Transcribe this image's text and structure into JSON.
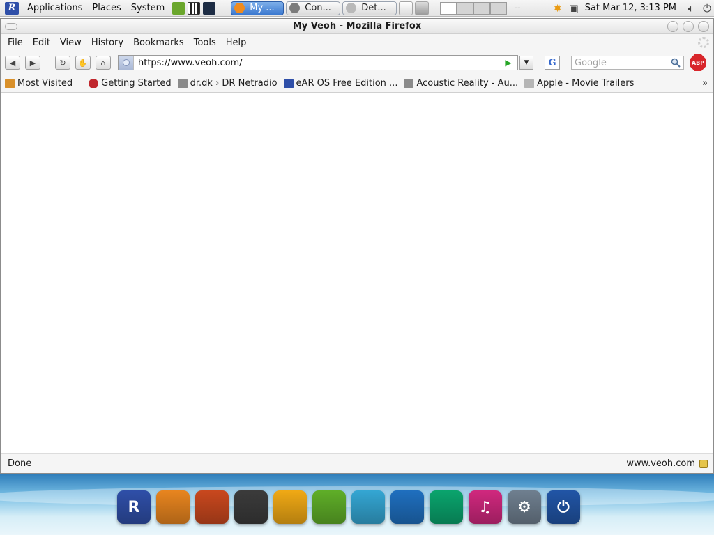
{
  "panel": {
    "logo_letter": "R",
    "menus": [
      "Applications",
      "Places",
      "System"
    ],
    "tasks": [
      "My ...",
      "Con...",
      "Det..."
    ],
    "pager_label": "--",
    "clock": "Sat Mar 12,  3:13 PM"
  },
  "window": {
    "title": "My Veoh - Mozilla Firefox"
  },
  "menubar": {
    "items": [
      "File",
      "Edit",
      "View",
      "History",
      "Bookmarks",
      "Tools",
      "Help"
    ]
  },
  "navbar": {
    "url": "https://www.veoh.com/",
    "search_placeholder": "Google",
    "engine_letter": "G",
    "abp_label": "ABP"
  },
  "bookmarks": {
    "items": [
      {
        "label": "Most Visited",
        "color": "#d9902a"
      },
      {
        "label": "Getting Started",
        "color": "#c0272d"
      },
      {
        "label": "dr.dk › DR Netradio",
        "color": "#8a8a8a"
      },
      {
        "label": "eAR OS Free Edition ...",
        "color": "#2f4fa8"
      },
      {
        "label": "Acoustic Reality - Au...",
        "color": "#8a8a8a"
      },
      {
        "label": "Apple - Movie Trailers",
        "color": "#b5b5b5"
      }
    ],
    "more": "»"
  },
  "status": {
    "left": "Done",
    "right": "www.veoh.com"
  },
  "dock": {
    "icons": [
      {
        "name": "rwin-icon",
        "letter": "R",
        "color": "#2f4fa8"
      },
      {
        "name": "firefox-icon",
        "letter": "",
        "color": "#e8851f"
      },
      {
        "name": "guitar-icon",
        "letter": "",
        "color": "#c9481e"
      },
      {
        "name": "flame-media-icon",
        "letter": "",
        "color": "#3b3b3b"
      },
      {
        "name": "coffee-icon",
        "letter": "",
        "color": "#f0a915"
      },
      {
        "name": "photo-icon",
        "letter": "",
        "color": "#5fae28"
      },
      {
        "name": "messenger-icon",
        "letter": "",
        "color": "#34a6d3"
      },
      {
        "name": "office-icon",
        "letter": "",
        "color": "#1f6fbf"
      },
      {
        "name": "feather-icon",
        "letter": "",
        "color": "#0aa46d"
      },
      {
        "name": "music-icon",
        "letter": "♫",
        "color": "#d0287e"
      },
      {
        "name": "settings-icon",
        "letter": "⚙",
        "color": "#6f7f8f"
      },
      {
        "name": "power-icon",
        "letter": "⏻",
        "color": "#2155a6"
      }
    ]
  }
}
